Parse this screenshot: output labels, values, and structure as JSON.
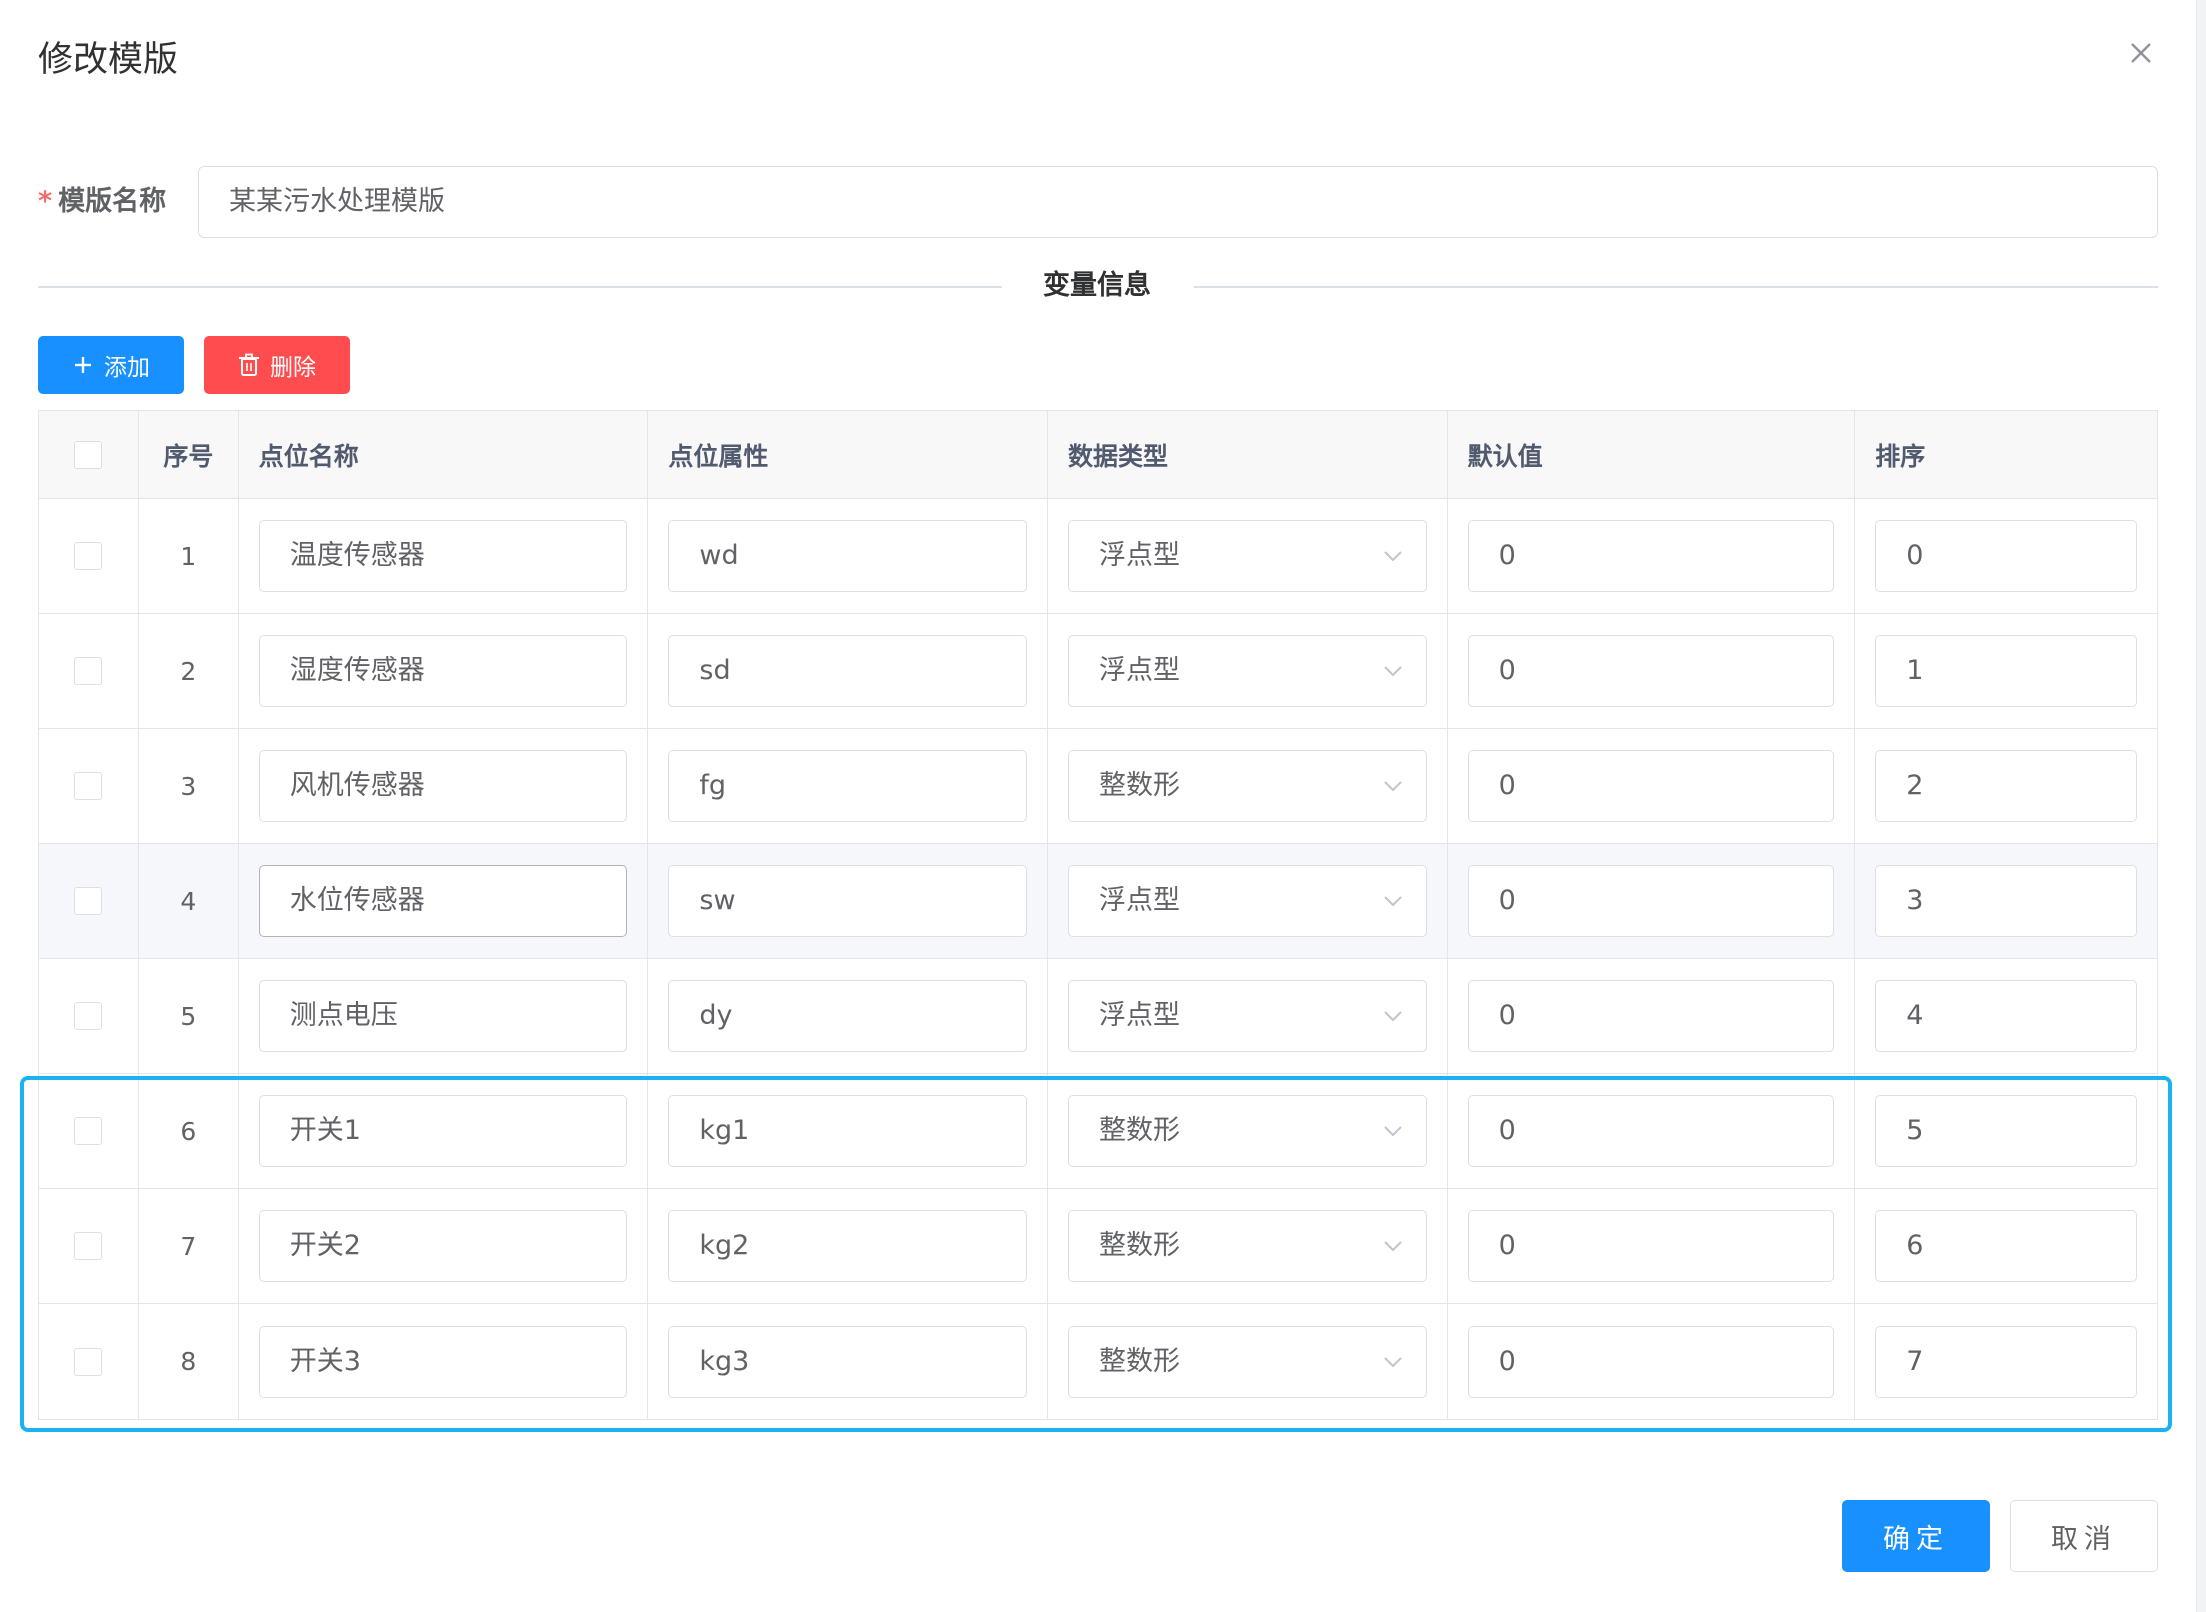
{
  "dialog": {
    "title": "修改模版",
    "close_icon": "close-icon"
  },
  "form": {
    "required_mark": "*",
    "name_label": "模版名称",
    "name_value": "某某污水处理模版"
  },
  "section": {
    "divider_text": "变量信息"
  },
  "toolbar": {
    "add_label": "添加",
    "add_icon": "plus-icon",
    "delete_label": "删除",
    "delete_icon": "trash-icon",
    "add_color": "#1890ff",
    "delete_color": "#ff4d4f"
  },
  "table": {
    "headers": {
      "index": "序号",
      "point_name": "点位名称",
      "point_attr": "点位属性",
      "data_type": "数据类型",
      "default_value": "默认值",
      "sort": "排序"
    },
    "rows": [
      {
        "index": "1",
        "point_name": "温度传感器",
        "point_attr": "wd",
        "data_type": "浮点型",
        "default_value": "0",
        "sort": "0"
      },
      {
        "index": "2",
        "point_name": "湿度传感器",
        "point_attr": "sd",
        "data_type": "浮点型",
        "default_value": "0",
        "sort": "1"
      },
      {
        "index": "3",
        "point_name": "风机传感器",
        "point_attr": "fg",
        "data_type": "整数形",
        "default_value": "0",
        "sort": "2"
      },
      {
        "index": "4",
        "point_name": "水位传感器",
        "point_attr": "sw",
        "data_type": "浮点型",
        "default_value": "0",
        "sort": "3"
      },
      {
        "index": "5",
        "point_name": "测点电压",
        "point_attr": "dy",
        "data_type": "浮点型",
        "default_value": "0",
        "sort": "4"
      },
      {
        "index": "6",
        "point_name": "开关1",
        "point_attr": "kg1",
        "data_type": "整数形",
        "default_value": "0",
        "sort": "5"
      },
      {
        "index": "7",
        "point_name": "开关2",
        "point_attr": "kg2",
        "data_type": "整数形",
        "default_value": "0",
        "sort": "6"
      },
      {
        "index": "8",
        "point_name": "开关3",
        "point_attr": "kg3",
        "data_type": "整数形",
        "default_value": "0",
        "sort": "7"
      }
    ]
  },
  "footer": {
    "ok_label": "确定",
    "cancel_label": "取消"
  },
  "colors": {
    "highlight_border": "#1ab3f0",
    "primary": "#1890ff",
    "danger": "#ff4d4f"
  }
}
